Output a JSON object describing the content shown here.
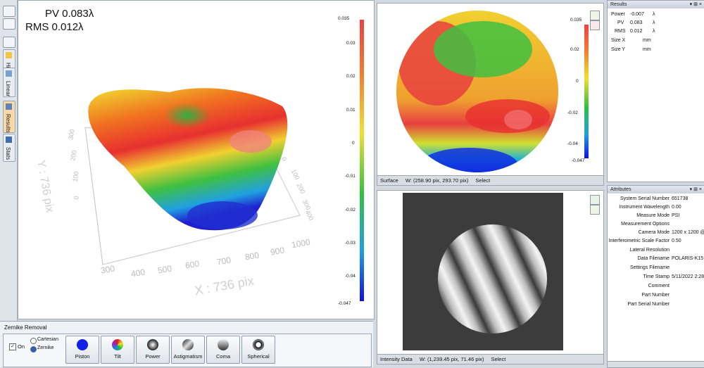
{
  "view3d": {
    "pv_label": "PV 0.083λ",
    "rms_label": "RMS 0.012λ",
    "left_y_ticks": [
      "300",
      "200",
      "100",
      "0"
    ],
    "front_x_ticks": [
      "300",
      "400",
      "500",
      "600",
      "700",
      "800",
      "900",
      "1000"
    ],
    "right_y_ticks": [
      "0",
      "100",
      "200",
      "300",
      "400"
    ],
    "y_axis_label": "Y : 736 pix",
    "x_axis_label": "X : 736 pix",
    "colorbar": {
      "top": "0.035",
      "ticks": [
        "0.03",
        "0.02",
        "0.01",
        "0",
        "-0.01",
        "-0.02",
        "-0.03",
        "-0.04"
      ],
      "bottom": "-0.047"
    }
  },
  "left_toolbar": {
    "tabs": [
      {
        "label": "Hide",
        "icon": "hide-icon"
      },
      {
        "label": "Linear",
        "icon": "linear-icon"
      },
      {
        "label": "Results",
        "icon": "results-icon"
      },
      {
        "label": "Stats",
        "icon": "stats-icon"
      }
    ]
  },
  "zernike": {
    "title": "Zernike Removal",
    "on_label": "On",
    "cartesian_label": "Cartesian",
    "zernike_label": "Zernike",
    "buttons": [
      {
        "label": "Piston",
        "icon": "piston-icon",
        "color": "#1020e8"
      },
      {
        "label": "Tilt",
        "icon": "tilt-icon",
        "color": "#f0a020"
      },
      {
        "label": "Power",
        "icon": "power-icon",
        "color": "#333333"
      },
      {
        "label": "Astigmatism",
        "icon": "astigmatism-icon",
        "color": "#555555"
      },
      {
        "label": "Coma",
        "icon": "coma-icon",
        "color": "#777777"
      },
      {
        "label": "Spherical",
        "icon": "spherical-icon",
        "color": "#222222"
      }
    ]
  },
  "surface": {
    "colorbar": {
      "top": "0.035",
      "ticks": [
        "0.02",
        "0",
        "-0.02",
        "-0.04"
      ],
      "bottom": "-0.047"
    },
    "status": {
      "name": "Surface",
      "coords": "W: (258.90 pix, 293.70 pix)",
      "mode": "Select"
    }
  },
  "intensity": {
    "status": {
      "name": "Intensity Data",
      "coords": "W: (1,239.45 pix, 71.46 pix)",
      "mode": "Select"
    }
  },
  "results": {
    "title": "Results",
    "rows": [
      {
        "key": "Power",
        "value": "-0.007",
        "unit": "λ"
      },
      {
        "key": "PV",
        "value": "0.083",
        "unit": "λ"
      },
      {
        "key": "RMS",
        "value": "0.012",
        "unit": "λ"
      },
      {
        "key": "Size X",
        "value": "",
        "unit": "mm"
      },
      {
        "key": "Size Y",
        "value": "",
        "unit": "mm"
      }
    ]
  },
  "attributes": {
    "title": "Attributes",
    "rows": [
      {
        "key": "System Serial Number",
        "value": "651738"
      },
      {
        "key": "Instrument Wavelength",
        "value": "0.00"
      },
      {
        "key": "Measure Mode",
        "value": "PSI"
      },
      {
        "key": "Measurement Options",
        "value": ""
      },
      {
        "key": "Camera Mode",
        "value": "1200 x 1200 @"
      },
      {
        "key": "Interferometric Scale Factor",
        "value": "0.50"
      },
      {
        "key": "Lateral Resolution",
        "value": ""
      },
      {
        "key": "Data Filename",
        "value": "POLARIS-K15 LC"
      },
      {
        "key": "Settings Filename",
        "value": ""
      },
      {
        "key": "Time Stamp",
        "value": "5/11/2022 2:28:"
      },
      {
        "key": "Comment",
        "value": ""
      },
      {
        "key": "Part Number",
        "value": ""
      },
      {
        "key": "Part Serial Number",
        "value": ""
      }
    ]
  }
}
